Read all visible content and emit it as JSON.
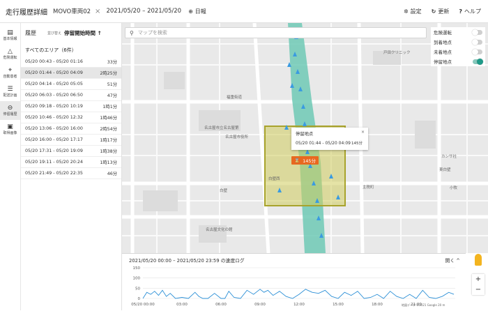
{
  "header": {
    "title": "走行履歴詳細",
    "vehicle": "MOVO車両02",
    "close_glyph": "×",
    "date_range": "2021/05/20 – 2021/05/20",
    "daily_label": "日報",
    "settings_label": "設定",
    "refresh_label": "更新",
    "help_label": "ヘルプ"
  },
  "nav": [
    {
      "label": "基本情報",
      "icon": "document-icon",
      "glyph": "▤"
    },
    {
      "label": "危険運転",
      "icon": "warning-icon",
      "glyph": "△"
    },
    {
      "label": "自動患者",
      "icon": "location-target-icon",
      "glyph": "⌖"
    },
    {
      "label": "配送計画",
      "icon": "list-icon",
      "glyph": "☰"
    },
    {
      "label": "停留履歴",
      "icon": "stop-icon",
      "glyph": "⊖"
    },
    {
      "label": "取得画像",
      "icon": "image-icon",
      "glyph": "▣"
    }
  ],
  "panel": {
    "title": "履歴",
    "sort_label": "並び替え",
    "sort_value": "停留開始時間",
    "sort_arrow": "↑",
    "area_heading": "すべてのエリア（6件）",
    "rows": [
      {
        "range": "05/20 00:43 - 05/20 01:16",
        "duration": "33分"
      },
      {
        "range": "05/20 01:44 - 05/20 04:09",
        "duration": "2時25分"
      },
      {
        "range": "05/20 04:14 - 05/20 05:05",
        "duration": "51分"
      },
      {
        "range": "05/20 06:03 - 05/20 06:50",
        "duration": "47分"
      },
      {
        "range": "05/20 09:18 - 05/20 10:19",
        "duration": "1時1分"
      },
      {
        "range": "05/20 10:46 - 05/20 12:32",
        "duration": "1時46分"
      },
      {
        "range": "05/20 13:06 - 05/20 16:00",
        "duration": "2時54分"
      },
      {
        "range": "05/20 16:00 - 05/20 17:17",
        "duration": "1時17分"
      },
      {
        "range": "05/20 17:31 - 05/20 19:09",
        "duration": "1時38分"
      },
      {
        "range": "05/20 19:11 - 05/20 20:24",
        "duration": "1時13分"
      },
      {
        "range": "05/20 21:49 - 05/20 22:35",
        "duration": "46分"
      }
    ]
  },
  "map": {
    "search_placeholder": "マップを検索",
    "layers": [
      {
        "label": "危険運転",
        "on": false
      },
      {
        "label": "到着地点",
        "on": false
      },
      {
        "label": "未着地点",
        "on": false
      },
      {
        "label": "停留地点",
        "on": true
      }
    ],
    "labels": [
      "戸田クリニック",
      "福重街道",
      "名古屋市立名古屋第",
      "名古屋市役所",
      "白壁",
      "名古屋文化の館",
      "主税町",
      "白壁西",
      "カンサ社",
      "東白壁",
      "小牧"
    ],
    "popup": {
      "title": "停留地点",
      "range": "05/20 01:44 - 05/20 04:09",
      "duration": "145分",
      "close": "×"
    },
    "badge_label": "145分",
    "credits": "地図データ ©2021 Google  20 m"
  },
  "speed_log": {
    "title": "2021/05/20 00:00 – 2021/05/20 23:59 の速度ログ",
    "toggle": "開く",
    "chart_data": {
      "type": "line",
      "title": "",
      "xlabel": "",
      "ylabel": "",
      "ylim": [
        0,
        150
      ],
      "y_ticks": [
        "150",
        "100",
        "50",
        "0"
      ],
      "x_ticks": [
        "05/20 00:00",
        "03:00",
        "06:00",
        "09:00",
        "12:00",
        "15:00",
        "18:00",
        "21:00"
      ],
      "series": [
        {
          "color": "#2b8fd6",
          "x_hours": [
            0,
            0.3,
            0.6,
            0.9,
            1.2,
            1.5,
            1.8,
            2.1,
            2.5,
            3.0,
            3.5,
            4.0,
            4.3,
            4.6,
            5.0,
            5.5,
            6.0,
            6.3,
            6.6,
            7.0,
            7.5,
            8.0,
            8.5,
            9.0,
            9.3,
            9.6,
            10.0,
            10.5,
            11.0,
            11.5,
            12.0,
            12.5,
            13.0,
            13.5,
            14.0,
            14.5,
            15.0,
            15.5,
            16.0,
            16.5,
            17.0,
            17.5,
            18.0,
            18.5,
            19.0,
            19.5,
            20.0,
            20.5,
            21.0,
            21.5,
            22.0,
            22.5,
            23.0,
            23.5,
            23.9
          ],
          "values": [
            0,
            30,
            20,
            35,
            15,
            40,
            10,
            25,
            0,
            5,
            0,
            30,
            10,
            0,
            0,
            25,
            0,
            0,
            35,
            5,
            0,
            40,
            20,
            45,
            30,
            40,
            15,
            35,
            10,
            0,
            20,
            45,
            30,
            25,
            40,
            10,
            0,
            30,
            15,
            35,
            0,
            5,
            20,
            0,
            35,
            10,
            0,
            20,
            0,
            40,
            5,
            0,
            10,
            30,
            20
          ]
        }
      ]
    }
  },
  "zoom": {
    "plus": "+",
    "minus": "−"
  }
}
